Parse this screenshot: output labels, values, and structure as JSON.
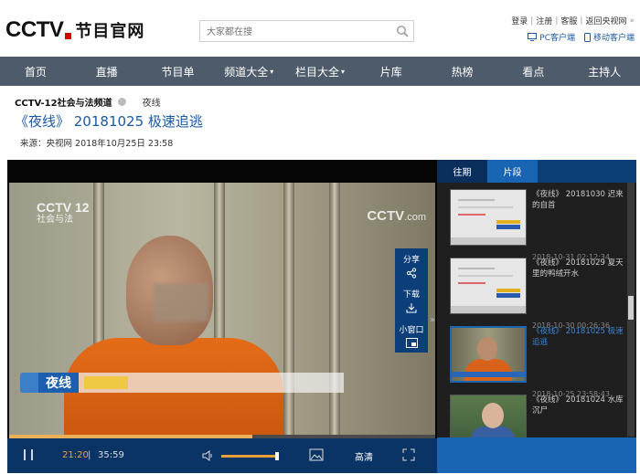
{
  "header": {
    "logo_latin": "CCTV",
    "logo_cn": "节目官网",
    "search_placeholder": "大家都在搜",
    "top_links": [
      "登录",
      "注册",
      "客服",
      "返回央视网"
    ],
    "top_links_suffix": "»",
    "pc_client": "PC客户端",
    "mobile_client": "移动客户端"
  },
  "nav": [
    "首页",
    "直播",
    "节目单",
    "频道大全",
    "栏目大全",
    "片库",
    "热榜",
    "看点",
    "主持人"
  ],
  "nav_dropdowns": [
    "频道大全",
    "栏目大全"
  ],
  "breadcrumb": {
    "channel": "CCTV-12社会与法频道",
    "show": "夜线"
  },
  "page_title": "《夜线》 20181025 极速追逃",
  "source_line": "来源：央视网  2018年10月25日 23:58",
  "player": {
    "watermark_left_main": "CCTV 12",
    "watermark_left_sub": "社会与法",
    "watermark_right": "CCTV",
    "watermark_right_suffix": ".com",
    "lower_third_show": "夜线",
    "side_tools": [
      "分享",
      "下载",
      "小窗口"
    ],
    "time_current": "21:20",
    "time_separator": "|",
    "time_total": "35:59",
    "quality": "高清",
    "progress_fraction": 0.57,
    "volume_fraction": 1.0
  },
  "playlist": {
    "tabs": [
      "往期",
      "片段"
    ],
    "active_tab": "往期",
    "items": [
      {
        "title": "《夜线》 20181030 迟来的自首",
        "date": "2018-10-31 02:12:34",
        "active": false
      },
      {
        "title": "《夜线》 20181029 夏天里的鸭绒开水",
        "date": "2018-10-30 00:26:36",
        "active": false
      },
      {
        "title": "《夜线》 20181025 极速追逃",
        "date": "2018-10-25 23:58:43",
        "active": true
      },
      {
        "title": "《夜线》 20181024 水库沉尸",
        "date": "",
        "active": false
      }
    ]
  },
  "colors": {
    "nav_bg": "#4e5b6b",
    "accent_blue": "#1a64b4",
    "title_blue": "#1b5aa6",
    "progress_orange": "#e8a13a"
  }
}
